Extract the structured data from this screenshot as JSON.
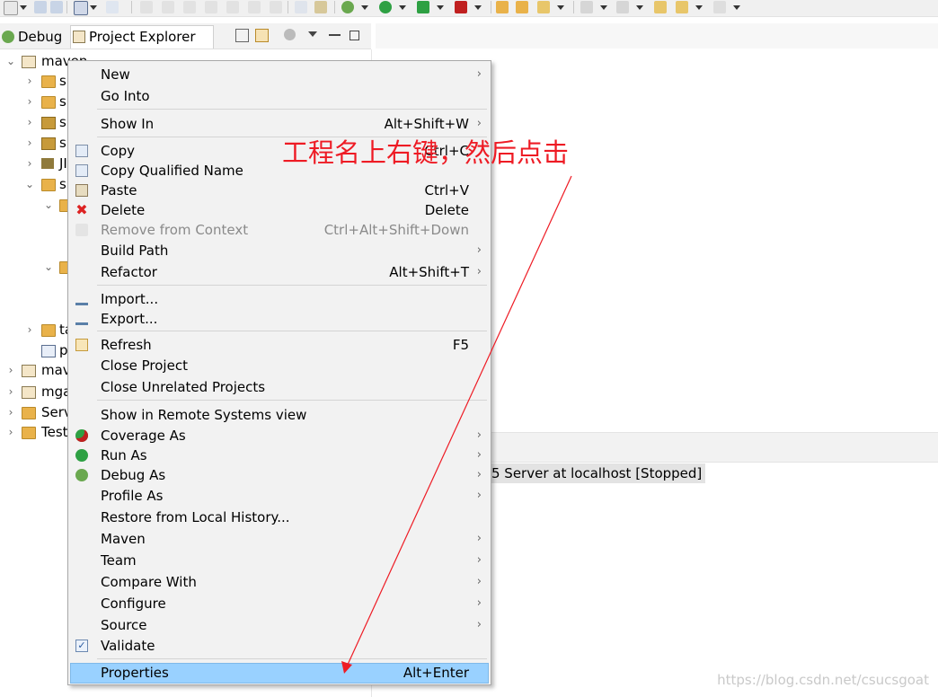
{
  "view_tabs": {
    "debug": "Debug",
    "project_explorer": "Project Explorer",
    "close_glyph": "⊠"
  },
  "tree": [
    {
      "twisty": "⌄",
      "icon": "maven-project-icon",
      "label": "maven"
    },
    {
      "twisty": "›",
      "icon": "source-folder-icon",
      "label": "s"
    },
    {
      "twisty": "›",
      "icon": "source-folder-icon",
      "label": "s"
    },
    {
      "twisty": "›",
      "icon": "package-icon",
      "label": "s"
    },
    {
      "twisty": "›",
      "icon": "package-icon",
      "label": "s"
    },
    {
      "twisty": "›",
      "icon": "library-icon",
      "label": "JI"
    },
    {
      "twisty": "⌄",
      "icon": "folder-icon",
      "label": "s"
    },
    {
      "twisty": "⌄",
      "icon": "folder-icon",
      "label": ""
    },
    {
      "twisty": "⌄",
      "icon": "folder-icon",
      "label": ""
    },
    {
      "twisty": "›",
      "icon": "folder-icon",
      "label": "ta"
    },
    {
      "twisty": "",
      "icon": "pom-file-icon",
      "label": "p"
    },
    {
      "twisty": "›",
      "icon": "maven-project-icon",
      "label": "mav"
    },
    {
      "twisty": "›",
      "icon": "project-icon",
      "label": "mga"
    },
    {
      "twisty": "›",
      "icon": "folder-icon",
      "label": "Serv"
    },
    {
      "twisty": "›",
      "icon": "folder-icon",
      "label": "Test"
    }
  ],
  "context_menu": {
    "items": [
      {
        "label": "New",
        "shortcut": "",
        "submenu": true
      },
      {
        "label": "Go Into",
        "shortcut": "",
        "submenu": false
      },
      {
        "label": "Show In",
        "shortcut": "Alt+Shift+W",
        "submenu": true
      },
      {
        "label": "Copy",
        "shortcut": "Ctrl+C",
        "submenu": false
      },
      {
        "label": "Copy Qualified Name",
        "shortcut": "",
        "submenu": false
      },
      {
        "label": "Paste",
        "shortcut": "Ctrl+V",
        "submenu": false
      },
      {
        "label": "Delete",
        "shortcut": "Delete",
        "submenu": false
      },
      {
        "label": "Remove from Context",
        "shortcut": "Ctrl+Alt+Shift+Down",
        "submenu": false
      },
      {
        "label": "Build Path",
        "shortcut": "",
        "submenu": true
      },
      {
        "label": "Refactor",
        "shortcut": "Alt+Shift+T",
        "submenu": true
      },
      {
        "label": "Import...",
        "shortcut": "",
        "submenu": false
      },
      {
        "label": "Export...",
        "shortcut": "",
        "submenu": false
      },
      {
        "label": "Refresh",
        "shortcut": "F5",
        "submenu": false
      },
      {
        "label": "Close Project",
        "shortcut": "",
        "submenu": false
      },
      {
        "label": "Close Unrelated Projects",
        "shortcut": "",
        "submenu": false
      },
      {
        "label": "Show in Remote Systems view",
        "shortcut": "",
        "submenu": false
      },
      {
        "label": "Coverage As",
        "shortcut": "",
        "submenu": true
      },
      {
        "label": "Run As",
        "shortcut": "",
        "submenu": true
      },
      {
        "label": "Debug As",
        "shortcut": "",
        "submenu": true
      },
      {
        "label": "Profile As",
        "shortcut": "",
        "submenu": true
      },
      {
        "label": "Restore from Local History...",
        "shortcut": "",
        "submenu": false
      },
      {
        "label": "Maven",
        "shortcut": "",
        "submenu": true
      },
      {
        "label": "Team",
        "shortcut": "",
        "submenu": true
      },
      {
        "label": "Compare With",
        "shortcut": "",
        "submenu": true
      },
      {
        "label": "Configure",
        "shortcut": "",
        "submenu": true
      },
      {
        "label": "Source",
        "shortcut": "",
        "submenu": true
      },
      {
        "label": "Validate",
        "shortcut": "",
        "submenu": false
      },
      {
        "label": "Properties",
        "shortcut": "Alt+Enter",
        "submenu": false
      }
    ],
    "submenu_glyph": "›",
    "check_glyph": "✓",
    "delete_glyph": "✖",
    "disabled_item": "Remove from Context",
    "selected_item": "Properties"
  },
  "servers_view": {
    "entry": "5 Server at localhost  [Stopped]"
  },
  "annotation": {
    "text": "工程名上右键，然后点击",
    "color": "#ee1b24"
  },
  "watermark": "https://blog.csdn.net/csucsgoat",
  "colors": {
    "selection": "#99d1ff",
    "menu_bg": "#f2f2f2",
    "annotation": "#ee1b24"
  }
}
